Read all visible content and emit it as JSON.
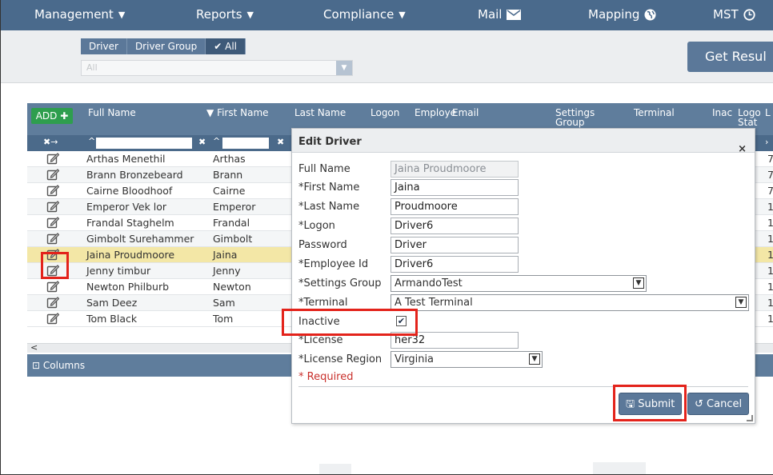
{
  "nav": {
    "items": [
      {
        "label": "Management",
        "caret": "▼"
      },
      {
        "label": "Reports",
        "caret": "▼"
      },
      {
        "label": "Compliance",
        "caret": "▼"
      },
      {
        "label": "Mail"
      },
      {
        "label": "Mapping"
      },
      {
        "label": "MST"
      }
    ]
  },
  "filter": {
    "segments": [
      "Driver",
      "Driver Group",
      "All"
    ],
    "active_check": "✔",
    "all_select_value": "All",
    "get_results": "Get Resul"
  },
  "grid": {
    "add_label": "ADD",
    "columns": [
      "Full Name",
      "First Name",
      "Last Name",
      "Logon",
      "Employe",
      "Email",
      "Settings Group",
      "Terminal",
      "Inac",
      "Logo Stat",
      "L"
    ],
    "rows": [
      {
        "full_name": "Arthas Menethil",
        "first_name": "Arthas",
        "tail": "7"
      },
      {
        "full_name": "Brann Bronzebeard",
        "first_name": "Brann",
        "tail": "7"
      },
      {
        "full_name": "Cairne Bloodhoof",
        "first_name": "Cairne",
        "tail": "7"
      },
      {
        "full_name": "Emperor Vek lor",
        "first_name": "Emperor",
        "tail": "1"
      },
      {
        "full_name": "Frandal Staghelm",
        "first_name": "Frandal",
        "tail": "1"
      },
      {
        "full_name": "Gimbolt Surehammer",
        "first_name": "Gimbolt",
        "tail": "1"
      },
      {
        "full_name": "Jaina Proudmoore",
        "first_name": "Jaina",
        "tail": "1"
      },
      {
        "full_name": "Jenny timbur",
        "first_name": "Jenny",
        "tail": "1"
      },
      {
        "full_name": "Newton Philburb",
        "first_name": "Newton",
        "tail": "1"
      },
      {
        "full_name": "Sam Deez",
        "first_name": "Sam",
        "tail": "1"
      },
      {
        "full_name": "Tom Black",
        "first_name": "Tom",
        "tail": "1"
      }
    ],
    "columns_footer": "Columns",
    "scroll_left": "<"
  },
  "modal": {
    "title": "Edit Driver",
    "close": "×",
    "fields": {
      "full_name_label": "Full Name",
      "full_name_value": "Jaina Proudmoore",
      "first_name_label": "*First Name",
      "first_name_value": "Jaina",
      "last_name_label": "*Last Name",
      "last_name_value": "Proudmoore",
      "logon_label": "*Logon",
      "logon_value": "Driver6",
      "password_label": "Password",
      "password_value": "Driver",
      "employee_id_label": "*Employee Id",
      "employee_id_value": "Driver6",
      "settings_group_label": "*Settings Group",
      "settings_group_value": "ArmandoTest",
      "terminal_label": "*Terminal",
      "terminal_value": "A Test Terminal",
      "inactive_label": "Inactive",
      "inactive_checked": "✔",
      "license_label": "*License",
      "license_value": "her32",
      "license_region_label": "*License Region",
      "license_region_value": "Virginia"
    },
    "required": "* Required",
    "submit": "Submit",
    "cancel": "Cancel"
  },
  "colors": {
    "nav_bg": "#4a6a8c",
    "highlight": "#e3231b",
    "selected_row": "#f3e7a6",
    "add_green": "#2e9e4e"
  }
}
